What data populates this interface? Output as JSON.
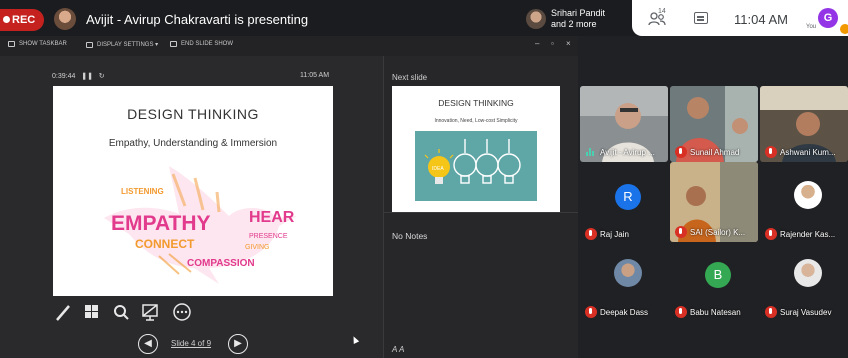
{
  "topbar": {
    "rec_label": "REC",
    "presenting_text": "Avijit - Avirup Chakravarti is presenting",
    "people_chip_line1": "Srihari Pandit",
    "people_chip_line2": "and 2 more",
    "participant_count": "14",
    "time": "11:04 AM",
    "you_initial": "G",
    "you_label": "You"
  },
  "console": {
    "toolbar": {
      "show_taskbar": "SHOW TASKBAR",
      "display_settings": "DISPLAY SETTINGS ▾",
      "end_slideshow": "END SLIDE SHOW"
    },
    "timer": "0:39:44",
    "clock": "11:05 AM",
    "slide": {
      "title": "DESIGN THINKING",
      "subtitle": "Empathy, Understanding & Immersion",
      "words": [
        "EMPATHY",
        "CONNECT",
        "COMPASSION",
        "HEAR",
        "LISTENING",
        "GIVING",
        "PRESENCE"
      ]
    },
    "nav_label": "Slide 4 of 9",
    "next_label": "Next slide",
    "next_slide": {
      "title": "DESIGN THINKING",
      "subtitle": "Innovation, Need, Low-cost Simplicity",
      "bulb_label": "IDEA"
    },
    "notes": "No Notes",
    "font_controls": "A  A"
  },
  "participants": [
    {
      "name": "Avijit - Avirup ...",
      "state": "speaking"
    },
    {
      "name": "Sunail Ahmad",
      "state": "muted"
    },
    {
      "name": "Ashwani Kum...",
      "state": "muted"
    },
    {
      "name": "Raj Jain",
      "state": "muted",
      "initial": "R",
      "color": "#1a73e8"
    },
    {
      "name": "SAI (Sailor) K...",
      "state": "muted"
    },
    {
      "name": "Rajender Kas...",
      "state": "muted"
    },
    {
      "name": "Deepak Dass",
      "state": "muted"
    },
    {
      "name": "Babu Natesan",
      "state": "muted",
      "initial": "B",
      "color": "#34a853"
    },
    {
      "name": "Suraj Vasudev",
      "state": "muted"
    }
  ],
  "colors": {
    "rec": "#c5221f",
    "mute": "#d93025",
    "you_avatar": "#9334e6",
    "slide_teal": "#5fa7a6",
    "bird_pink": "#e23a8c",
    "bird_orange": "#f29a2e"
  }
}
